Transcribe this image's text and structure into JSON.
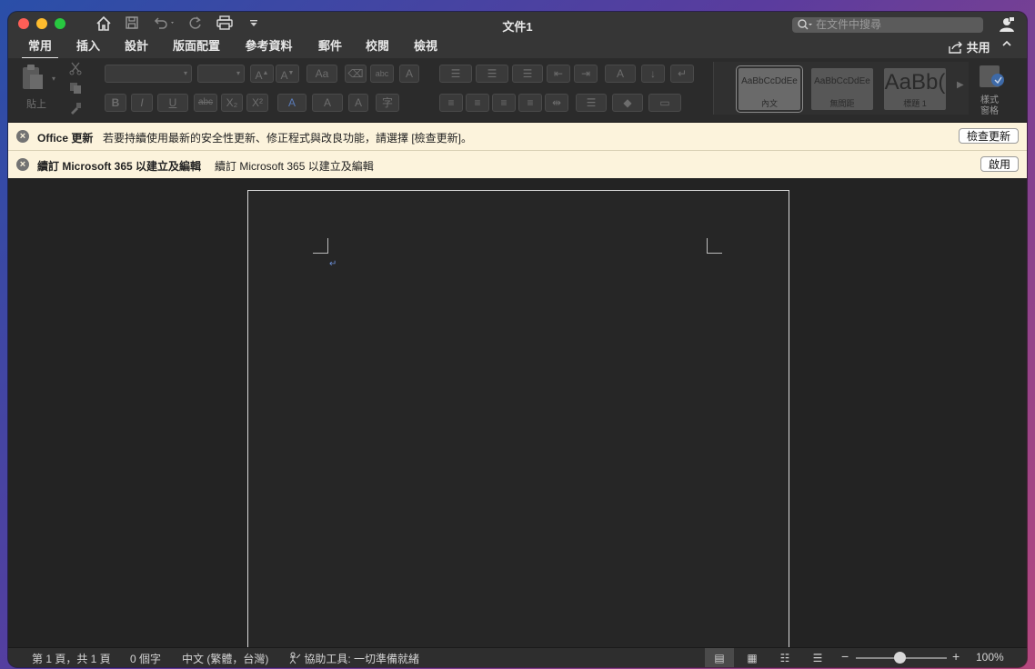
{
  "window": {
    "title": "文件1",
    "search_placeholder": "在文件中搜尋"
  },
  "quick_access": {
    "icons": [
      "home-icon",
      "save-icon",
      "undo-icon",
      "redo-icon",
      "print-icon",
      "customize-icon"
    ]
  },
  "tabs": [
    "常用",
    "插入",
    "設計",
    "版面配置",
    "參考資料",
    "郵件",
    "校閱",
    "檢視"
  ],
  "active_tab": "常用",
  "share_label": "共用",
  "ribbon": {
    "paste_label": "貼上",
    "styles": [
      {
        "sample": "AaBbCcDdEe",
        "name": "內文"
      },
      {
        "sample": "AaBbCcDdEe",
        "name": "無間距"
      },
      {
        "sample": "AaBb(",
        "name": "標題 1"
      }
    ],
    "styles_pane_label": "樣式\n窗格"
  },
  "notifications": [
    {
      "title": "Office 更新",
      "message": "若要持續使用最新的安全性更新、修正程式與改良功能，請選擇 [檢查更新]。",
      "button": "檢查更新"
    },
    {
      "title": "續訂 Microsoft 365 以建立及編輯",
      "message": "續訂 Microsoft 365 以建立及編輯",
      "button": "啟用"
    }
  ],
  "status": {
    "page": "第 1 頁，共 1 頁",
    "words": "0 個字",
    "language": "中文 (繁體，台灣)",
    "accessibility": "協助工具: 一切準備就緒",
    "zoom": "100%"
  }
}
